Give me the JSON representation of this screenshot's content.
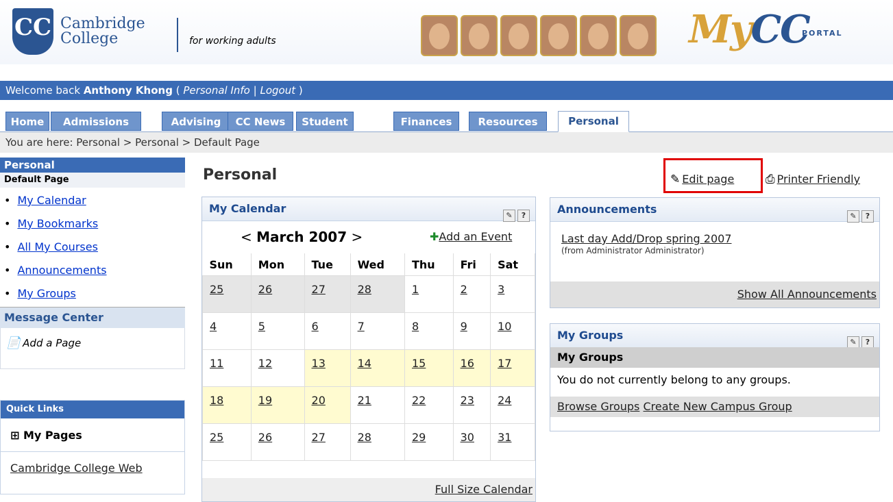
{
  "header": {
    "logo_line1": "Cambridge",
    "logo_line2": "College",
    "tagline": "for working adults",
    "portal_brand_my": "My",
    "portal_brand_cc": "CC",
    "portal_badge": "PORTAL"
  },
  "welcome": {
    "prefix": "Welcome back",
    "user": "Anthony Khong",
    "open": "(",
    "personal_info": "Personal Info",
    "sep": "|",
    "logout": "Logout",
    "close": ")"
  },
  "tabs": [
    {
      "label": "Home"
    },
    {
      "label": "Admissions"
    },
    {
      "label": "Advising"
    },
    {
      "label": "CC News"
    },
    {
      "label": "Student"
    },
    {
      "label": "Finances"
    },
    {
      "label": "Resources"
    },
    {
      "label": "Personal",
      "active": true
    }
  ],
  "breadcrumb": "You are here:  Personal > Personal > Default Page",
  "sidebar": {
    "title": "Personal",
    "subtitle": "Default Page",
    "items": [
      {
        "label": "My Calendar"
      },
      {
        "label": "My Bookmarks"
      },
      {
        "label": "All My Courses"
      },
      {
        "label": "Announcements"
      },
      {
        "label": "My Groups"
      }
    ],
    "message_center": "Message Center",
    "add_page": "Add a Page"
  },
  "quick_links": {
    "title": "Quick Links",
    "my_pages": "My Pages",
    "expand_symbol": "⊞",
    "web_link": "Cambridge College Web"
  },
  "main": {
    "title": "Personal",
    "edit_page": "Edit page",
    "printer_friendly": "Printer Friendly"
  },
  "calendar": {
    "title": "My Calendar",
    "prev": "<",
    "month": "March 2007",
    "next": ">",
    "add_event": "Add an Event",
    "days": [
      "Sun",
      "Mon",
      "Tue",
      "Wed",
      "Thu",
      "Fri",
      "Sat"
    ],
    "weeks": [
      [
        "25",
        "26",
        "27",
        "28",
        "1",
        "2",
        "3"
      ],
      [
        "4",
        "5",
        "6",
        "7",
        "8",
        "9",
        "10"
      ],
      [
        "11",
        "12",
        "13",
        "14",
        "15",
        "16",
        "17"
      ],
      [
        "18",
        "19",
        "20",
        "21",
        "22",
        "23",
        "24"
      ],
      [
        "25",
        "26",
        "27",
        "28",
        "29",
        "30",
        "31"
      ]
    ],
    "full_size": "Full Size Calendar"
  },
  "announcements": {
    "title": "Announcements",
    "item_title": "Last day Add/Drop spring 2007",
    "item_from": "(from Administrator Administrator)",
    "show_all": "Show All Announcements"
  },
  "groups": {
    "title": "My Groups",
    "subheader": "My Groups",
    "empty_text": "You do not currently belong to any groups.",
    "browse": "Browse Groups",
    "create": "Create New Campus Group"
  },
  "help_symbol": "?",
  "colors": {
    "brand_blue": "#3a6bb5",
    "tab_blue": "#6f95cc",
    "highlight_yellow": "#fffbd0",
    "edit_box_red": "#e00000"
  }
}
